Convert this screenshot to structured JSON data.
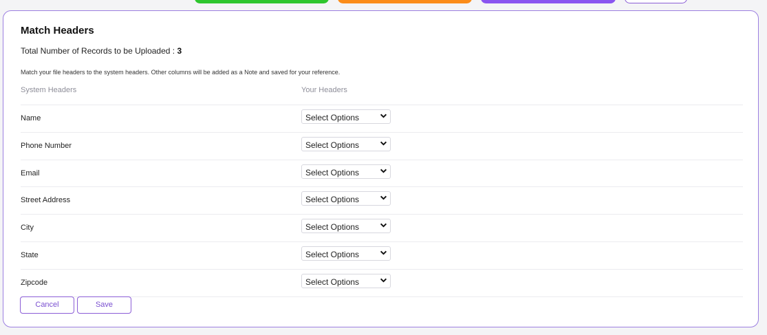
{
  "card": {
    "title": "Match Headers",
    "records_label": "Total Number of Records to be Uploaded : ",
    "records_count": "3",
    "note": "Match your file headers to the system headers. Other columns will be added as a Note and saved for your reference.",
    "col_system": "System Headers",
    "col_yours": "Your Headers"
  },
  "rows": [
    {
      "label": "Name",
      "selected": "Select Options"
    },
    {
      "label": "Phone Number",
      "selected": "Select Options"
    },
    {
      "label": "Email",
      "selected": "Select Options"
    },
    {
      "label": "Street Address",
      "selected": "Select Options"
    },
    {
      "label": "City",
      "selected": "Select Options"
    },
    {
      "label": "State",
      "selected": "Select Options"
    },
    {
      "label": "Zipcode",
      "selected": "Select Options"
    }
  ],
  "buttons": {
    "cancel": "Cancel",
    "save": "Save"
  },
  "colors": {
    "accent": "#8a5cd6",
    "pill_green": "#2ec62e",
    "pill_orange": "#fb8c1a",
    "pill_purple": "#8a55f0"
  },
  "icons": {
    "select_arrow": "chevron-down-icon"
  }
}
